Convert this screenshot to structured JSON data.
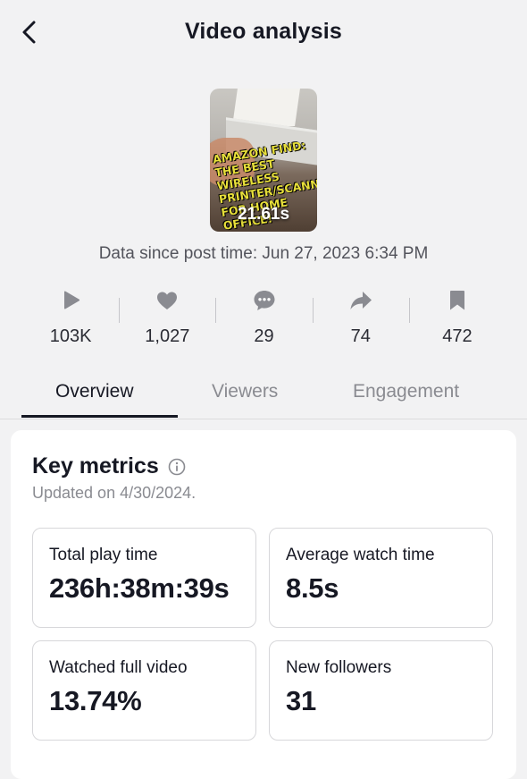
{
  "header": {
    "title": "Video analysis",
    "back_icon": "chevron-left-icon"
  },
  "video": {
    "overlay_text": "AMAZON FIND:\nTHE BEST WIRELESS\nPRINTER/SCANNER\nFOR HOME OFFICE!",
    "duration": "21.61s"
  },
  "data_since": "Data since post time: Jun 27, 2023 6:34 PM",
  "stats": [
    {
      "icon": "play-icon",
      "value": "103K"
    },
    {
      "icon": "heart-icon",
      "value": "1,027"
    },
    {
      "icon": "comment-icon",
      "value": "29"
    },
    {
      "icon": "share-icon",
      "value": "74"
    },
    {
      "icon": "bookmark-icon",
      "value": "472"
    }
  ],
  "tabs": [
    {
      "label": "Overview",
      "active": true
    },
    {
      "label": "Viewers",
      "active": false
    },
    {
      "label": "Engagement",
      "active": false
    }
  ],
  "key_metrics": {
    "title": "Key metrics",
    "updated": "Updated on 4/30/2024.",
    "items": [
      {
        "label": "Total play time",
        "value": "236h:38m:39s"
      },
      {
        "label": "Average watch time",
        "value": "8.5s"
      },
      {
        "label": "Watched full video",
        "value": "13.74%"
      },
      {
        "label": "New followers",
        "value": "31"
      }
    ]
  },
  "colors": {
    "text": "#161823",
    "muted": "#8a8b91",
    "icon_gray": "#8a8b91",
    "background": "#f2f2f3"
  }
}
